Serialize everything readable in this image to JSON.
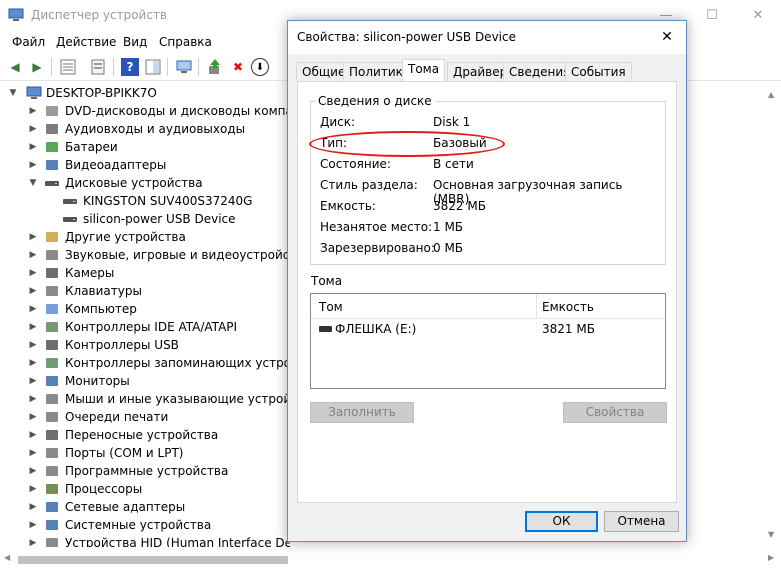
{
  "window": {
    "title": "Диспетчер устройств",
    "minimize": "—",
    "maximize": "☐",
    "close": "✕"
  },
  "menu": [
    "Файл",
    "Действие",
    "Вид",
    "Справка"
  ],
  "toolbar": {
    "back": "◀",
    "forward": "▶",
    "remove": "✖",
    "update": "⬇",
    "help": "?"
  },
  "tree": {
    "root": "DESKTOP-BPIKK7O",
    "items": [
      {
        "label": "DVD-дисководы и дисководы компакт-дисков",
        "icon": "dvd-icon",
        "expanded": false
      },
      {
        "label": "Аудиовходы и аудиовыходы",
        "icon": "speaker-icon",
        "expanded": false
      },
      {
        "label": "Батареи",
        "icon": "battery-icon",
        "expanded": false
      },
      {
        "label": "Видеоадаптеры",
        "icon": "display-adapter-icon",
        "expanded": false
      },
      {
        "label": "Дисковые устройства",
        "icon": "disk-icon",
        "expanded": true
      },
      {
        "label": "KINGSTON SUV400S37240G",
        "icon": "disk-icon",
        "child": true
      },
      {
        "label": "silicon-power USB Device",
        "icon": "disk-icon",
        "child": true
      },
      {
        "label": "Другие устройства",
        "icon": "unknown-device-icon",
        "expanded": false
      },
      {
        "label": "Звуковые, игровые и видеоустройства",
        "icon": "sound-icon",
        "expanded": false
      },
      {
        "label": "Камеры",
        "icon": "camera-icon",
        "expanded": false
      },
      {
        "label": "Клавиатуры",
        "icon": "keyboard-icon",
        "expanded": false
      },
      {
        "label": "Компьютер",
        "icon": "computer-icon",
        "expanded": false
      },
      {
        "label": "Контроллеры IDE ATA/ATAPI",
        "icon": "ide-controller-icon",
        "expanded": false
      },
      {
        "label": "Контроллеры USB",
        "icon": "usb-icon",
        "expanded": false
      },
      {
        "label": "Контроллеры запоминающих устройств",
        "icon": "storage-controller-icon",
        "expanded": false
      },
      {
        "label": "Мониторы",
        "icon": "monitor-icon",
        "expanded": false
      },
      {
        "label": "Мыши и иные указывающие устройства",
        "icon": "mouse-icon",
        "expanded": false
      },
      {
        "label": "Очереди печати",
        "icon": "printer-icon",
        "expanded": false
      },
      {
        "label": "Переносные устройства",
        "icon": "portable-device-icon",
        "expanded": false
      },
      {
        "label": "Порты (COM и LPT)",
        "icon": "port-icon",
        "expanded": false
      },
      {
        "label": "Программные устройства",
        "icon": "software-device-icon",
        "expanded": false
      },
      {
        "label": "Процессоры",
        "icon": "processor-icon",
        "expanded": false
      },
      {
        "label": "Сетевые адаптеры",
        "icon": "network-adapter-icon",
        "expanded": false
      },
      {
        "label": "Системные устройства",
        "icon": "system-device-icon",
        "expanded": false
      },
      {
        "label": "Устройства HID (Human Interface Devices)",
        "icon": "hid-icon",
        "expanded": false
      }
    ]
  },
  "dialog": {
    "title": "Свойства: silicon-power USB Device",
    "close": "✕",
    "tabs": [
      "Общие",
      "Политика",
      "Тома",
      "Драйвер",
      "Сведения",
      "События"
    ],
    "active_tab": "Тома",
    "disk_info_legend": "Сведения о диске",
    "properties": [
      {
        "key": "Диск:",
        "value": "Disk 1"
      },
      {
        "key": "Тип:",
        "value": "Базовый"
      },
      {
        "key": "Состояние:",
        "value": "В сети"
      },
      {
        "key": "Стиль раздела:",
        "value": "Основная загрузочная запись (MBR)"
      },
      {
        "key": "Емкость:",
        "value": "3822 МБ"
      },
      {
        "key": "Незанятое место:",
        "value": "1 МБ"
      },
      {
        "key": "Зарезервировано:",
        "value": "0 МБ"
      }
    ],
    "volumes_label": "Тома",
    "volumes_columns": [
      "Том",
      "Емкость"
    ],
    "volumes": [
      {
        "name": "ФЛЕШКА (E:)",
        "capacity": "3821 МБ"
      }
    ],
    "populate_button": "Заполнить",
    "properties_button": "Свойства",
    "ok_button": "ОК",
    "cancel_button": "Отмена"
  },
  "colors": {
    "highlight_ellipse": "#e01b1b",
    "dialog_border": "#6a8bc9",
    "default_button_border": "#0078d7"
  }
}
